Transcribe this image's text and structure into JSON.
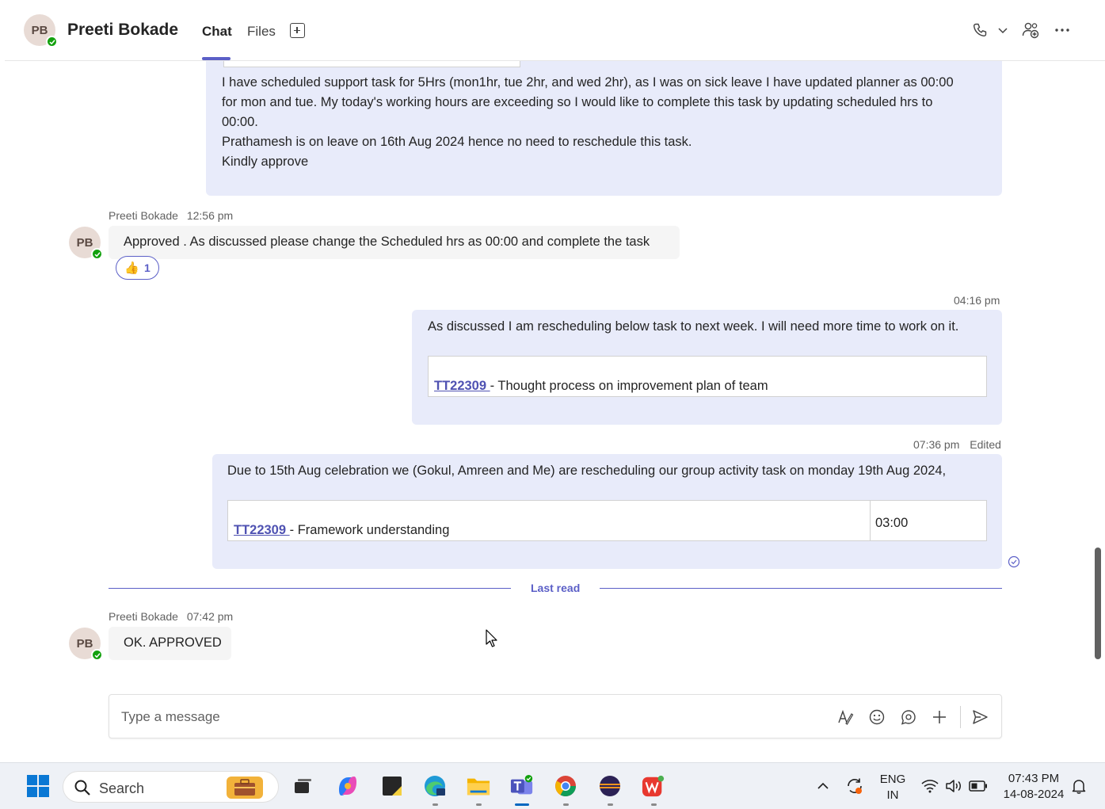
{
  "header": {
    "avatar_initials": "PB",
    "contact_name": "Preeti Bokade",
    "tabs": [
      {
        "label": "Chat",
        "active": true
      },
      {
        "label": "Files",
        "active": false
      }
    ],
    "icons": [
      "add-tab-icon",
      "phone-icon",
      "chevron-down-icon",
      "people-add-icon",
      "more-icon"
    ]
  },
  "messages": {
    "m1": {
      "lines": [
        "I have scheduled support task for 5Hrs (mon1hr, tue 2hr, and wed 2hr), as I was on sick leave I have updated planner as 00:00",
        "for mon and tue. My today's working hours are exceeding so I would like to complete this task by updating scheduled hrs to",
        "00:00.",
        "Prathamesh is on leave on 16th Aug 2024 hence no need to reschedule this task.",
        "Kindly approve"
      ]
    },
    "m2": {
      "sender": "Preeti Bokade",
      "time": "12:56 pm",
      "avatar_initials": "PB",
      "text": "Approved . As discussed please change the Scheduled hrs as 00:00 and complete the task",
      "reaction_emoji": "👍",
      "reaction_count": "1"
    },
    "m3": {
      "time": "04:16 pm",
      "text": "As discussed I am rescheduling below task to next week. I will need more time to work on it.",
      "task_id": "TT22309 ",
      "task_desc": "- Thought process on improvement plan of team"
    },
    "m4": {
      "time": "07:36 pm",
      "edited": "Edited",
      "text": "Due to 15th Aug celebration we (Gokul, Amreen and Me) are rescheduling our group activity task on monday 19th Aug 2024,",
      "task_id": "TT22309 ",
      "task_desc": "- Framework understanding",
      "task_hours": "03:00"
    },
    "last_read": "Last read",
    "m5": {
      "sender": "Preeti Bokade",
      "time": "07:42 pm",
      "avatar_initials": "PB",
      "text": "OK. APPROVED"
    }
  },
  "composer": {
    "placeholder": "Type a message"
  },
  "taskbar": {
    "search_label": "Search",
    "language": "ENG",
    "region": "IN",
    "time": "07:43 PM",
    "date": "14-08-2024"
  },
  "colors": {
    "accent": "#5b5fc7",
    "outgoing_bubble": "#e8ebfa",
    "incoming_bubble": "#f5f5f5",
    "presence": "#13a10e"
  }
}
